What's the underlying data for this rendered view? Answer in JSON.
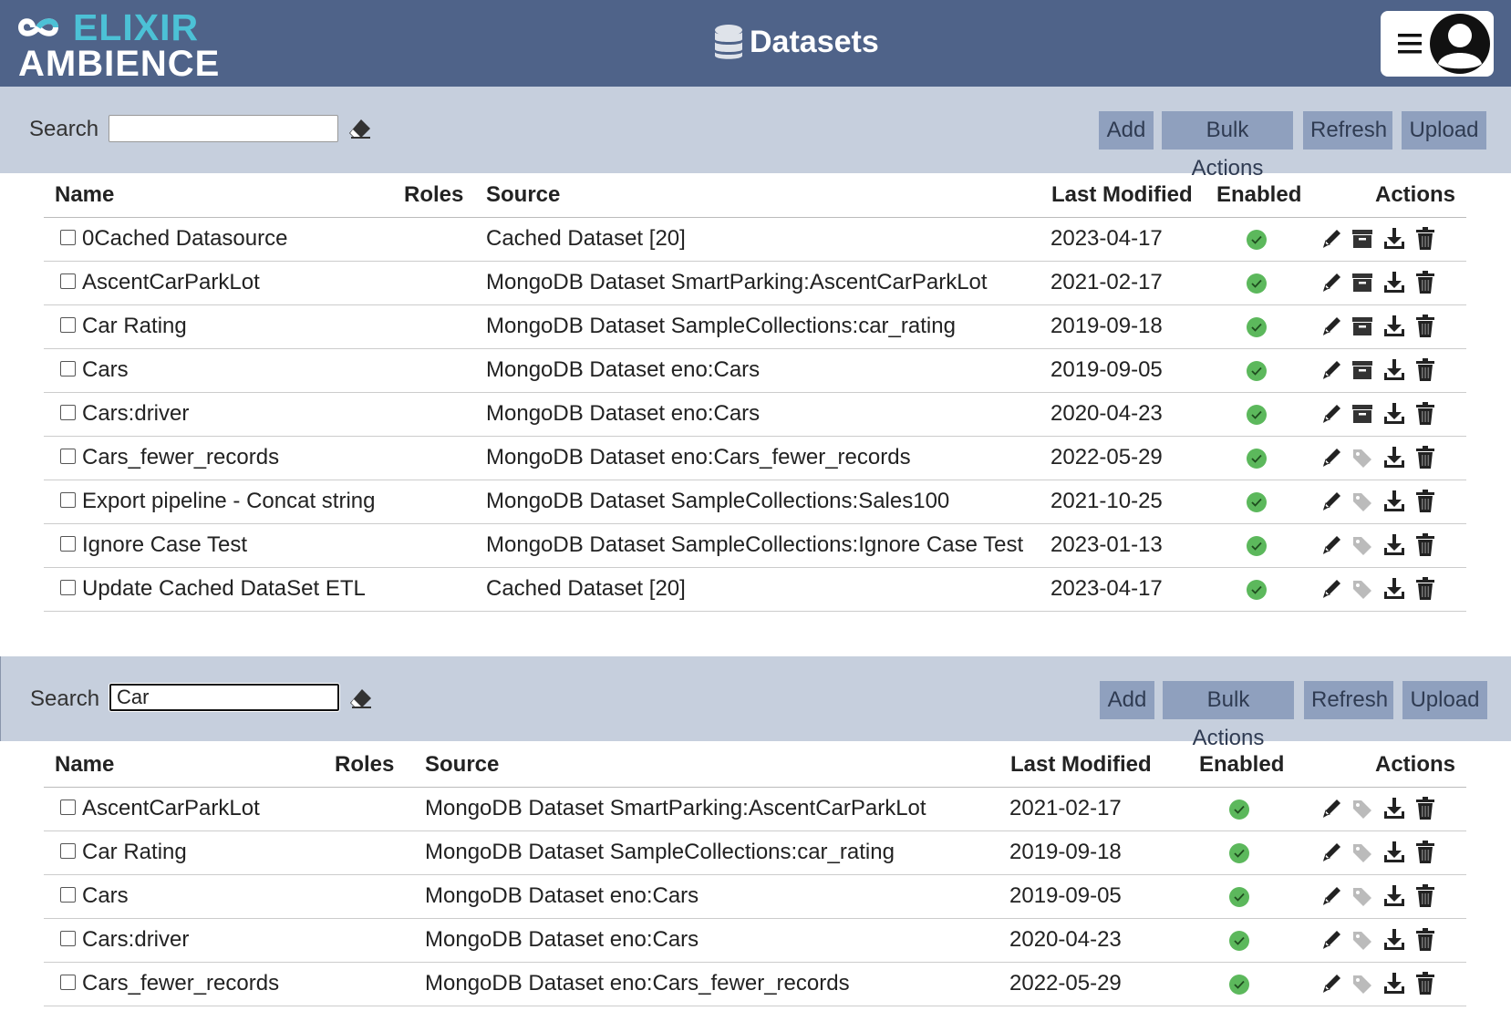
{
  "header": {
    "logo_line1": "ELIXIR",
    "logo_line2": "AMBIENCE",
    "title": "Datasets",
    "title_icon": "database-icon",
    "menu_icon": "hamburger-menu-icon",
    "avatar_icon": "user-avatar-icon"
  },
  "colors": {
    "header_bg": "#4f6389",
    "toolbar_bg": "#c6cfdd",
    "button_bg": "#8fa0be",
    "logo_accent": "#4cc1d6",
    "enabled_green": "#5cb85c"
  },
  "panel1": {
    "search_label": "Search",
    "search_value": "",
    "buttons": {
      "add": "Add",
      "bulk": "Bulk Actions",
      "refresh": "Refresh",
      "upload": "Upload"
    },
    "columns": {
      "name": "Name",
      "roles": "Roles",
      "source": "Source",
      "modified": "Last Modified",
      "enabled": "Enabled",
      "actions": "Actions"
    },
    "rows": [
      {
        "name": "0Cached Datasource",
        "source": "Cached Dataset [20]",
        "modified": "2023-04-17",
        "enabled": true,
        "second_action": "archive-icon"
      },
      {
        "name": "AscentCarParkLot",
        "source": "MongoDB Dataset SmartParking:AscentCarParkLot",
        "modified": "2021-02-17",
        "enabled": true,
        "second_action": "archive-icon"
      },
      {
        "name": "Car Rating",
        "source": "MongoDB Dataset SampleCollections:car_rating",
        "modified": "2019-09-18",
        "enabled": true,
        "second_action": "archive-icon"
      },
      {
        "name": "Cars",
        "source": "MongoDB Dataset eno:Cars",
        "modified": "2019-09-05",
        "enabled": true,
        "second_action": "archive-icon"
      },
      {
        "name": "Cars:driver",
        "source": "MongoDB Dataset eno:Cars",
        "modified": "2020-04-23",
        "enabled": true,
        "second_action": "archive-icon"
      },
      {
        "name": "Cars_fewer_records",
        "source": "MongoDB Dataset eno:Cars_fewer_records",
        "modified": "2022-05-29",
        "enabled": true,
        "second_action": "tag-icon"
      },
      {
        "name": "Export pipeline - Concat string",
        "source": "MongoDB Dataset SampleCollections:Sales100",
        "modified": "2021-10-25",
        "enabled": true,
        "second_action": "tag-icon"
      },
      {
        "name": "Ignore Case Test",
        "source": "MongoDB Dataset SampleCollections:Ignore Case Test",
        "modified": "2023-01-13",
        "enabled": true,
        "second_action": "tag-icon"
      },
      {
        "name": "Update Cached DataSet ETL",
        "source": "Cached Dataset [20]",
        "modified": "2023-04-17",
        "enabled": true,
        "second_action": "tag-icon"
      }
    ]
  },
  "panel2": {
    "search_label": "Search",
    "search_value": "Car",
    "buttons": {
      "add": "Add",
      "bulk": "Bulk Actions",
      "refresh": "Refresh",
      "upload": "Upload"
    },
    "columns": {
      "name": "Name",
      "roles": "Roles",
      "source": "Source",
      "modified": "Last Modified",
      "enabled": "Enabled",
      "actions": "Actions"
    },
    "rows": [
      {
        "name": "AscentCarParkLot",
        "source": "MongoDB Dataset SmartParking:AscentCarParkLot",
        "modified": "2021-02-17",
        "enabled": true,
        "second_action": "tag-icon"
      },
      {
        "name": "Car Rating",
        "source": "MongoDB Dataset SampleCollections:car_rating",
        "modified": "2019-09-18",
        "enabled": true,
        "second_action": "tag-icon"
      },
      {
        "name": "Cars",
        "source": "MongoDB Dataset eno:Cars",
        "modified": "2019-09-05",
        "enabled": true,
        "second_action": "tag-icon"
      },
      {
        "name": "Cars:driver",
        "source": "MongoDB Dataset eno:Cars",
        "modified": "2020-04-23",
        "enabled": true,
        "second_action": "tag-icon"
      },
      {
        "name": "Cars_fewer_records",
        "source": "MongoDB Dataset eno:Cars_fewer_records",
        "modified": "2022-05-29",
        "enabled": true,
        "second_action": "tag-icon"
      }
    ]
  }
}
